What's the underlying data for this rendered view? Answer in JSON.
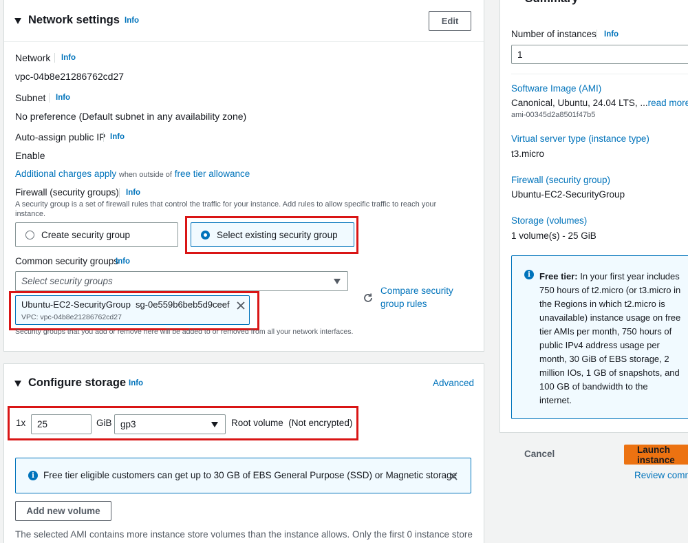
{
  "network": {
    "title": "Network settings",
    "info": "Info",
    "edit_label": "Edit",
    "network_label": "Network",
    "network_value": "vpc-04b8e21286762cd27",
    "subnet_label": "Subnet",
    "subnet_value": "No preference (Default subnet in any availability zone)",
    "public_ip_label": "Auto-assign public IP",
    "public_ip_value": "Enable",
    "charges_link": "Additional charges apply",
    "charges_mid": "when outside of",
    "free_tier_link": "free tier allowance",
    "firewall_label": "Firewall (security groups)",
    "firewall_desc_line1": "A security group is a set of firewall rules that control the traffic for your instance. Add rules to allow specific traffic to reach your",
    "firewall_desc_line2": "instance.",
    "create_sg_label": "Create security group",
    "select_sg_label": "Select existing security group",
    "common_sg_label": "Common security groups",
    "select_sg_placeholder": "Select security groups",
    "compare_line1": "Compare security",
    "compare_line2": "group rules",
    "token_name": "Ubuntu-EC2-SecurityGroup",
    "token_id": "sg-0e559b6beb5d9ceef",
    "token_vpc": "VPC: vpc-04b8e21286762cd27",
    "sg_footer": "Security groups that you add or remove here will be added to or removed from all your network interfaces."
  },
  "storage": {
    "title": "Configure storage",
    "info": "Info",
    "advanced_label": "Advanced",
    "multiplier": "1x",
    "size_value": "25",
    "unit": "GiB",
    "volume_type": "gp3",
    "root_label": "Root volume  (Not encrypted)",
    "alert_text": "Free tier eligible customers can get up to 30 GB of EBS General Purpose (SSD) or Magnetic storage",
    "add_volume_label": "Add new volume",
    "ami_note": "The selected AMI contains more instance store volumes than the instance allows. Only the first 0 instance store"
  },
  "summary": {
    "title": "Summary",
    "instances_label": "Number of instances",
    "info": "Info",
    "instances_value": "1",
    "ami_label": "Software Image (AMI)",
    "ami_value": "Canonical, Ubuntu, 24.04 LTS, ...",
    "ami_read_more": "read more",
    "ami_id": "ami-00345d2a8501f47b5",
    "instance_type_label": "Virtual server type (instance type)",
    "instance_type_value": "t3.micro",
    "firewall_label": "Firewall (security group)",
    "firewall_value": "Ubuntu-EC2-SecurityGroup",
    "storage_label": "Storage (volumes)",
    "storage_value": "1 volume(s) - 25 GiB",
    "free_tier_bold": "Free tier:",
    "free_tier_lines": [
      "In your first year includes",
      "750 hours of t2.micro (or t3.micro in",
      "the Regions in which t2.micro is",
      "unavailable) instance usage on free",
      "tier AMIs per month, 750 hours of",
      "public IPv4 address usage per",
      "month, 30 GiB of EBS storage, 2",
      "million IOs, 1 GB of snapshots, and",
      "100 GB of bandwidth to the",
      "internet."
    ],
    "cancel_label": "Cancel",
    "launch_label": "Launch instance",
    "review_label": "Review commands"
  },
  "colors": {
    "link": "#0073bb",
    "highlight": "#d91515",
    "launch": "#ec7211"
  }
}
